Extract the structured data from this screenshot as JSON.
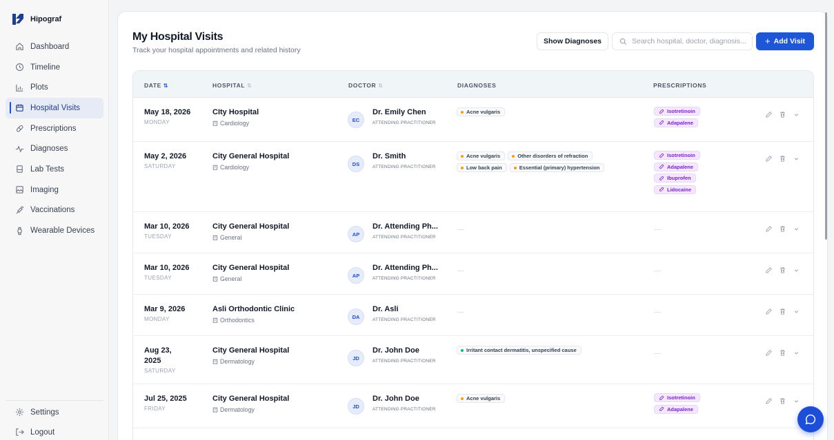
{
  "app": {
    "name": "Hipograf"
  },
  "sidebar": {
    "items": [
      {
        "label": "Dashboard",
        "icon": "home-icon",
        "active": false
      },
      {
        "label": "Timeline",
        "icon": "clock-icon",
        "active": false
      },
      {
        "label": "Plots",
        "icon": "bar-chart-icon",
        "active": false
      },
      {
        "label": "Hospital Visits",
        "icon": "calendar-icon",
        "active": true
      },
      {
        "label": "Prescriptions",
        "icon": "pill-icon",
        "active": false
      },
      {
        "label": "Diagnoses",
        "icon": "activity-icon",
        "active": false
      },
      {
        "label": "Lab Tests",
        "icon": "test-tube-icon",
        "active": false
      },
      {
        "label": "Imaging",
        "icon": "image-icon",
        "active": false
      },
      {
        "label": "Vaccinations",
        "icon": "syringe-icon",
        "active": false
      },
      {
        "label": "Wearable Devices",
        "icon": "watch-icon",
        "active": false
      }
    ],
    "bottom": [
      {
        "label": "Settings",
        "icon": "gear-icon"
      },
      {
        "label": "Logout",
        "icon": "logout-icon"
      }
    ]
  },
  "page": {
    "title": "My Hospital Visits",
    "subtitle": "Track your hospital appointments and related history"
  },
  "toolbar": {
    "show_diagnoses_label": "Show Diagnoses",
    "search_placeholder": "Search hospital, doctor, diagnosis...",
    "search_value": "",
    "add_visit_label": "Add Visit"
  },
  "table": {
    "columns": {
      "date": "DATE",
      "hospital": "HOSPITAL",
      "doctor": "DOCTOR",
      "diagnoses": "DIAGNOSES",
      "prescriptions": "PRESCRIPTIONS"
    },
    "empty_mark": "—",
    "rows": [
      {
        "date": "May 18, 2026",
        "weekday": "MONDAY",
        "hospital": "CIty Hospital",
        "department": "Cardiology",
        "initials": "EC",
        "doctor": "Dr. Emily Chen",
        "role": "ATTENDING PRACTITIONER",
        "diagnoses": [
          "Acne vulgaris"
        ],
        "prescriptions": [
          "Isotretinoin",
          "Adapalene"
        ]
      },
      {
        "date": "May 2, 2026",
        "weekday": "SATURDAY",
        "hospital": "City General Hospital",
        "department": "Cardiology",
        "initials": "DS",
        "doctor": "Dr. Smith",
        "role": "ATTENDING PRACTITIONER",
        "diagnoses": [
          "Acne vulgaris",
          "Other disorders of refraction",
          "Low back pain",
          "Essential (primary) hypertension"
        ],
        "prescriptions": [
          "Isotretinoin",
          "Adapalene",
          "Ibuprofen",
          "Lidocaine"
        ]
      },
      {
        "date": "Mar 10, 2026",
        "weekday": "TUESDAY",
        "hospital": "City General Hospital",
        "department": "General",
        "initials": "AP",
        "doctor": "Dr. Attending Ph...",
        "role": "ATTENDING PRACTITIONER",
        "diagnoses": [],
        "prescriptions": []
      },
      {
        "date": "Mar 10, 2026",
        "weekday": "TUESDAY",
        "hospital": "City General Hospital",
        "department": "General",
        "initials": "AP",
        "doctor": "Dr. Attending Ph...",
        "role": "ATTENDING PRACTITIONER",
        "diagnoses": [],
        "prescriptions": []
      },
      {
        "date": "Mar 9, 2026",
        "weekday": "MONDAY",
        "hospital": "Asli Orthodontic Clinic",
        "department": "Orthodontics",
        "initials": "DA",
        "doctor": "Dr. Asli",
        "role": "ATTENDING PRACTITIONER",
        "diagnoses": [],
        "prescriptions": []
      },
      {
        "date": "Aug 23, 2025",
        "weekday": "SATURDAY",
        "hospital": "City General Hospital",
        "department": "Dermatology",
        "initials": "JD",
        "doctor": "Dr. John Doe",
        "role": "ATTENDING PRACTITIONER",
        "diagnoses": [
          "Irritant contact dermatitis, unspecified cause"
        ],
        "prescriptions": []
      },
      {
        "date": "Jul 25, 2025",
        "weekday": "FRIDAY",
        "hospital": "City General Hospital",
        "department": "Dermatology",
        "initials": "JD",
        "doctor": "Dr. John Doe",
        "role": "ATTENDING PRACTITIONER",
        "diagnoses": [
          "Acne vulgaris"
        ],
        "prescriptions": [
          "Isotretinoin",
          "Adapalene"
        ]
      }
    ]
  },
  "colors": {
    "accent": "#1d56d6",
    "active_bg": "#e6ebf5",
    "rx_chip": "#f3e8ff",
    "rx_text": "#7e22ce",
    "dot_amber": "#f59e0b",
    "dot_green": "#10b981"
  }
}
